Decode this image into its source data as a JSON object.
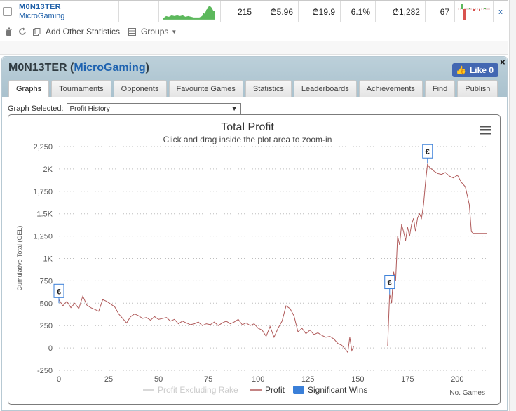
{
  "results_row": {
    "player_name": "M0N13TER",
    "site": "MicroGaming",
    "games": "215",
    "profit_a": "₾5.96",
    "profit_b": "₾19.9",
    "roi": "6.1%",
    "total": "₾1,282",
    "rank": "67",
    "remove_label": "x"
  },
  "toolbar": {
    "add_stats_label": "Add Other Statistics",
    "groups_label": "Groups"
  },
  "panel": {
    "player_name": "M0N13TER",
    "site": "MicroGaming",
    "like_label": "Like",
    "like_count": "0",
    "close_label": "×"
  },
  "tabs": [
    {
      "label": "Graphs",
      "active": true
    },
    {
      "label": "Tournaments",
      "active": false
    },
    {
      "label": "Opponents",
      "active": false
    },
    {
      "label": "Favourite Games",
      "active": false
    },
    {
      "label": "Statistics",
      "active": false
    },
    {
      "label": "Leaderboards",
      "active": false
    },
    {
      "label": "Achievements",
      "active": false
    },
    {
      "label": "Find",
      "active": false
    },
    {
      "label": "Publish",
      "active": false
    }
  ],
  "graph_select": {
    "label": "Graph Selected:",
    "value": "Profit History"
  },
  "colors": {
    "profit_line": "#b05a5a",
    "excl_rake": "#cccccc",
    "significant": "#3a7fd8",
    "header": "#b0c6d1",
    "link": "#1e5fa8",
    "sparkline": "#5cb85c"
  },
  "chart_data": {
    "type": "line",
    "title": "Total Profit",
    "subtitle": "Click and drag inside the plot area to zoom-in",
    "ylabel": "Cumulative Total (GEL)",
    "xlabel": "No. Games",
    "ylim": [
      -250,
      2250
    ],
    "xlim": [
      0,
      215
    ],
    "y_ticks": [
      -250,
      0,
      250,
      500,
      750,
      1000,
      1250,
      1500,
      1750,
      2000,
      2250
    ],
    "y_tick_labels": [
      "-250",
      "0",
      "250",
      "500",
      "750",
      "1K",
      "1,250",
      "1.5K",
      "1,750",
      "2K",
      "2,250"
    ],
    "x_ticks": [
      0,
      25,
      50,
      75,
      100,
      125,
      150,
      175,
      200
    ],
    "grid": true,
    "legend": [
      "Profit Excluding Rake",
      "Profit",
      "Significant Wins"
    ],
    "series": [
      {
        "name": "Profit",
        "x": [
          0,
          2,
          4,
          6,
          8,
          10,
          12,
          14,
          16,
          18,
          20,
          22,
          24,
          26,
          28,
          30,
          32,
          34,
          36,
          38,
          40,
          42,
          44,
          46,
          48,
          50,
          52,
          54,
          56,
          58,
          60,
          62,
          64,
          66,
          68,
          70,
          72,
          74,
          76,
          78,
          80,
          82,
          84,
          86,
          88,
          90,
          92,
          94,
          96,
          98,
          100,
          102,
          104,
          106,
          108,
          110,
          112,
          114,
          116,
          118,
          120,
          122,
          124,
          126,
          128,
          130,
          132,
          134,
          136,
          138,
          140,
          142,
          144,
          145,
          146,
          147,
          148,
          150,
          155,
          160,
          165,
          166,
          167,
          168,
          169,
          170,
          171,
          172,
          173,
          174,
          175,
          176,
          177,
          178,
          179,
          180,
          181,
          182,
          183,
          184,
          185,
          186,
          188,
          190,
          192,
          194,
          196,
          198,
          200,
          202,
          204,
          205,
          206,
          207,
          208,
          210,
          212,
          215
        ],
        "y": [
          540,
          470,
          520,
          450,
          500,
          440,
          580,
          480,
          450,
          430,
          410,
          540,
          520,
          490,
          460,
          380,
          330,
          280,
          350,
          380,
          360,
          330,
          340,
          310,
          350,
          320,
          330,
          340,
          300,
          320,
          270,
          300,
          280,
          260,
          270,
          290,
          250,
          270,
          260,
          290,
          250,
          280,
          300,
          270,
          290,
          320,
          260,
          280,
          250,
          270,
          220,
          200,
          130,
          240,
          120,
          220,
          300,
          470,
          440,
          360,
          180,
          220,
          160,
          200,
          150,
          170,
          140,
          120,
          130,
          100,
          50,
          30,
          -20,
          -50,
          120,
          -30,
          20,
          20,
          20,
          20,
          20,
          600,
          500,
          850,
          750,
          1250,
          1150,
          1380,
          1300,
          1200,
          1350,
          1250,
          1380,
          1450,
          1300,
          1450,
          1500,
          1450,
          1600,
          1850,
          2050,
          2020,
          1980,
          1950,
          1940,
          1960,
          1920,
          1900,
          1930,
          1850,
          1800,
          1700,
          1600,
          1300,
          1280,
          1280,
          1280,
          1280
        ]
      }
    ],
    "significant_wins": [
      {
        "x": 0,
        "y": 500
      },
      {
        "x": 166,
        "y": 600
      },
      {
        "x": 185,
        "y": 2060
      }
    ],
    "significant_marker": "€"
  }
}
